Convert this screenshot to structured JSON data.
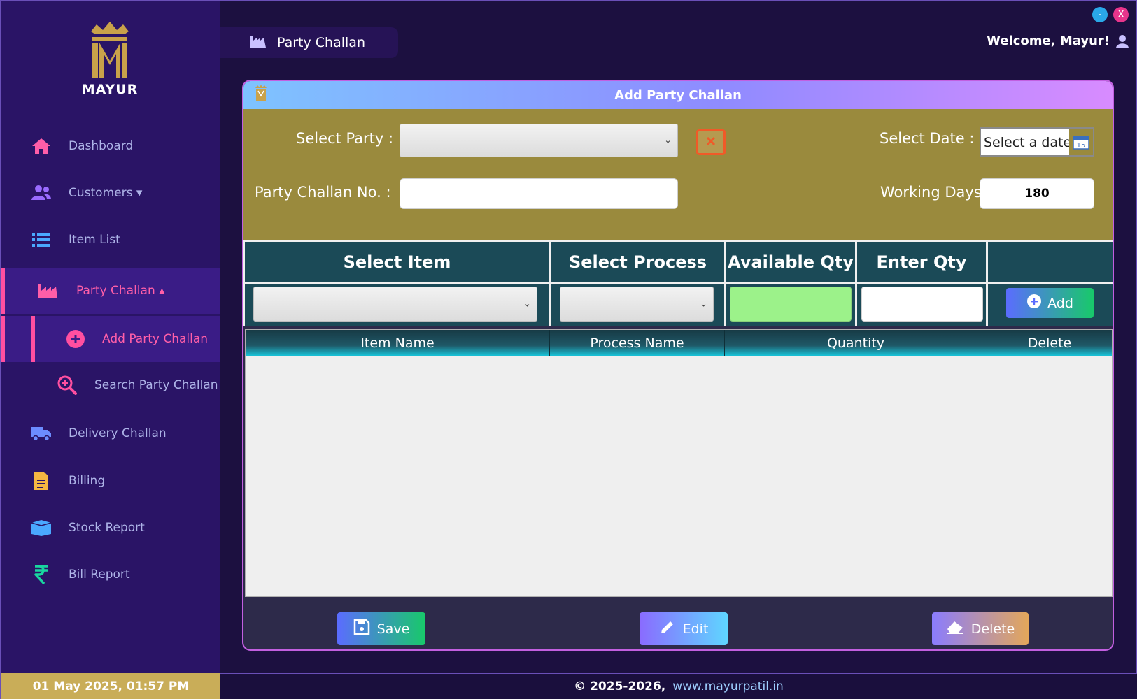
{
  "app": {
    "logo_text": "MAYUR",
    "window_controls": {
      "minimize": "-",
      "close": "X"
    }
  },
  "header": {
    "page_title": "Party Challan",
    "welcome": "Welcome, Mayur!"
  },
  "sidebar": {
    "items": [
      {
        "label": "Dashboard",
        "icon": "home-icon"
      },
      {
        "label": "Customers ▾",
        "icon": "users-icon"
      },
      {
        "label": "Item List",
        "icon": "list-icon"
      },
      {
        "label": "Party Challan ▴",
        "icon": "industry-icon"
      },
      {
        "label": "Add Party Challan",
        "icon": "plus-circle-icon"
      },
      {
        "label": "Search Party Challan",
        "icon": "search-plus-icon"
      },
      {
        "label": "Delivery Challan",
        "icon": "truck-icon"
      },
      {
        "label": "Billing",
        "icon": "invoice-icon"
      },
      {
        "label": "Stock Report",
        "icon": "box-icon"
      },
      {
        "label": "Bill Report",
        "icon": "rupee-icon"
      }
    ]
  },
  "form": {
    "title": "Add Party Challan",
    "select_party_label": "Select Party :",
    "select_party_value": "",
    "select_date_label": "Select Date :",
    "date_placeholder": "Select a date",
    "calendar_day": "15",
    "challan_no_label": "Party Challan No. :",
    "challan_no_value": "",
    "working_days_label": "Working Days :",
    "working_days_value": "180"
  },
  "entry": {
    "headers": [
      "Select Item",
      "Select Process",
      "Available Qty",
      "Enter Qty"
    ],
    "add_label": "Add"
  },
  "grid": {
    "columns": [
      "Item Name",
      "Process Name",
      "Quantity",
      "Delete"
    ],
    "rows": []
  },
  "actions": {
    "save": "Save",
    "edit": "Edit",
    "delete": "Delete"
  },
  "footer": {
    "datetime": "01 May 2025, 01:57 PM",
    "copyright": "© 2025-2026,",
    "website": "www.mayurpatil.in"
  },
  "colors": {
    "sidebar_bg": "#2a1466",
    "form_bg": "#9a8a3d",
    "accent_pink": "#ff4fa0",
    "table_header": "#1b4a57"
  }
}
